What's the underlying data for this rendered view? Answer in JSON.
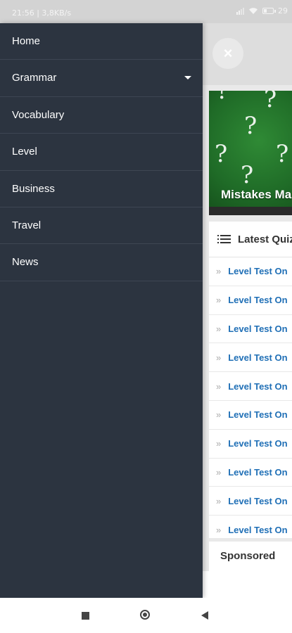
{
  "status_bar": {
    "time": "21:56",
    "network_speed": "3,8KB/s",
    "battery_text": "29"
  },
  "drawer": {
    "items": [
      {
        "label": "Home",
        "has_dropdown": false
      },
      {
        "label": "Grammar",
        "has_dropdown": true
      },
      {
        "label": "Vocabulary",
        "has_dropdown": false
      },
      {
        "label": "Level",
        "has_dropdown": false
      },
      {
        "label": "Business",
        "has_dropdown": false
      },
      {
        "label": "Travel",
        "has_dropdown": false
      },
      {
        "label": "News",
        "has_dropdown": false
      }
    ]
  },
  "page": {
    "close_icon": "×",
    "featured_title": "Mistakes Ma",
    "latest_header": "Latest Quiz",
    "quiz_items": [
      "Level Test On",
      "Level Test On",
      "Level Test On",
      "Level Test On",
      "Level Test On",
      "Level Test On",
      "Level Test On",
      "Level Test On",
      "Level Test On",
      "Level Test On"
    ],
    "sponsored_label": "Sponsored"
  },
  "colors": {
    "drawer_bg": "#2c3440",
    "link_blue": "#1f6fb6",
    "card_green": "#2f8a35"
  },
  "icons": {
    "close": "close-icon",
    "list": "list-icon",
    "chevron": "double-chevron-icon",
    "caret": "caret-down-icon"
  }
}
